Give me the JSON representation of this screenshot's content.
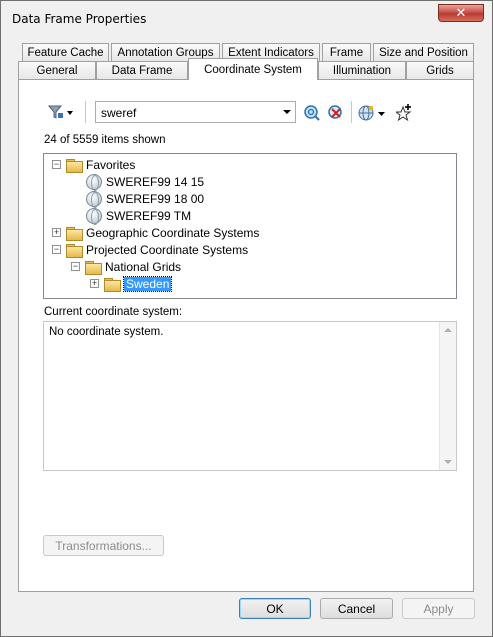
{
  "window": {
    "title": "Data Frame Properties",
    "close_glyph": "✕"
  },
  "tabs_row1": [
    "Feature Cache",
    "Annotation Groups",
    "Extent Indicators",
    "Frame",
    "Size and Position"
  ],
  "tabs_row2": [
    "General",
    "Data Frame",
    "Coordinate System",
    "Illumination",
    "Grids"
  ],
  "active_tab": "Coordinate System",
  "toolbar": {
    "filter_icon": "filter-icon",
    "search_value": "sweref",
    "search_icon": "search-icon",
    "clear_icon": "clear-search-icon",
    "globe_icon": "globe-icon",
    "add_favorite_icon": "add-favorite-icon"
  },
  "items_shown": "24 of 5559 items shown",
  "tree": {
    "favorites": "Favorites",
    "fav_items": [
      "SWEREF99 14 15",
      "SWEREF99 18 00",
      "SWEREF99 TM"
    ],
    "geographic": "Geographic Coordinate Systems",
    "projected": "Projected Coordinate Systems",
    "national_grids": "National Grids",
    "sweden": "Sweden"
  },
  "current_cs": {
    "label": "Current coordinate system:",
    "value": "No coordinate system."
  },
  "buttons": {
    "transformations": "Transformations...",
    "ok": "OK",
    "cancel": "Cancel",
    "apply": "Apply"
  }
}
